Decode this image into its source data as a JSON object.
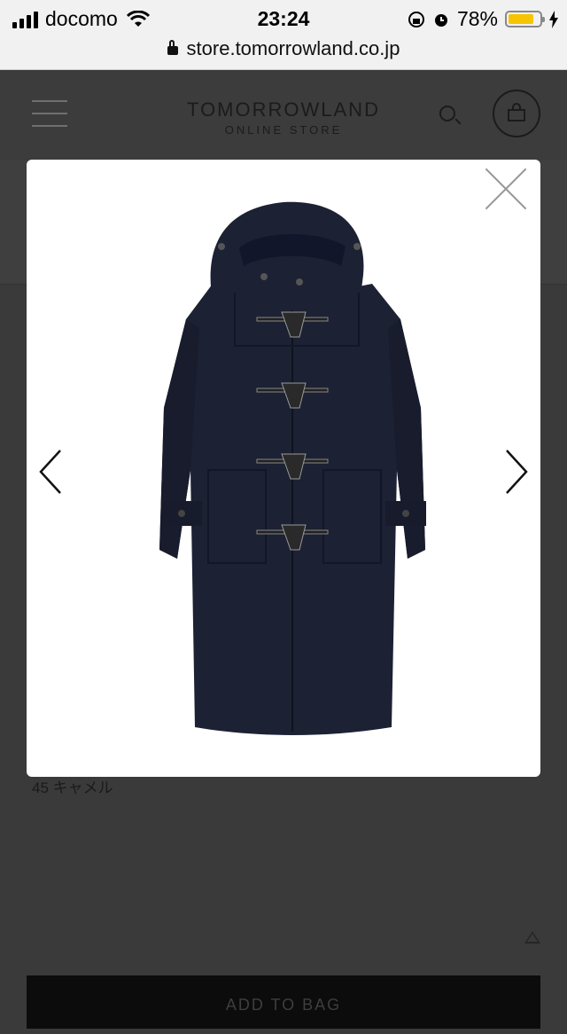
{
  "status_bar": {
    "carrier": "docomo",
    "time": "23:24",
    "battery": "78%",
    "battery_level": 0.78
  },
  "browser": {
    "url": "store.tomorrowland.co.jp"
  },
  "header": {
    "brand": "TOMORROWLAND",
    "sub": "ONLINE STORE"
  },
  "page": {
    "color_option": "45 キャメル",
    "add_to_bag": "ADD TO BAG"
  },
  "lightbox": {
    "image_alt": "navy duffle coat"
  },
  "colors": {
    "overlay": "#3a3a3a",
    "coat": "#1c2133",
    "battery": "#f6c400"
  }
}
